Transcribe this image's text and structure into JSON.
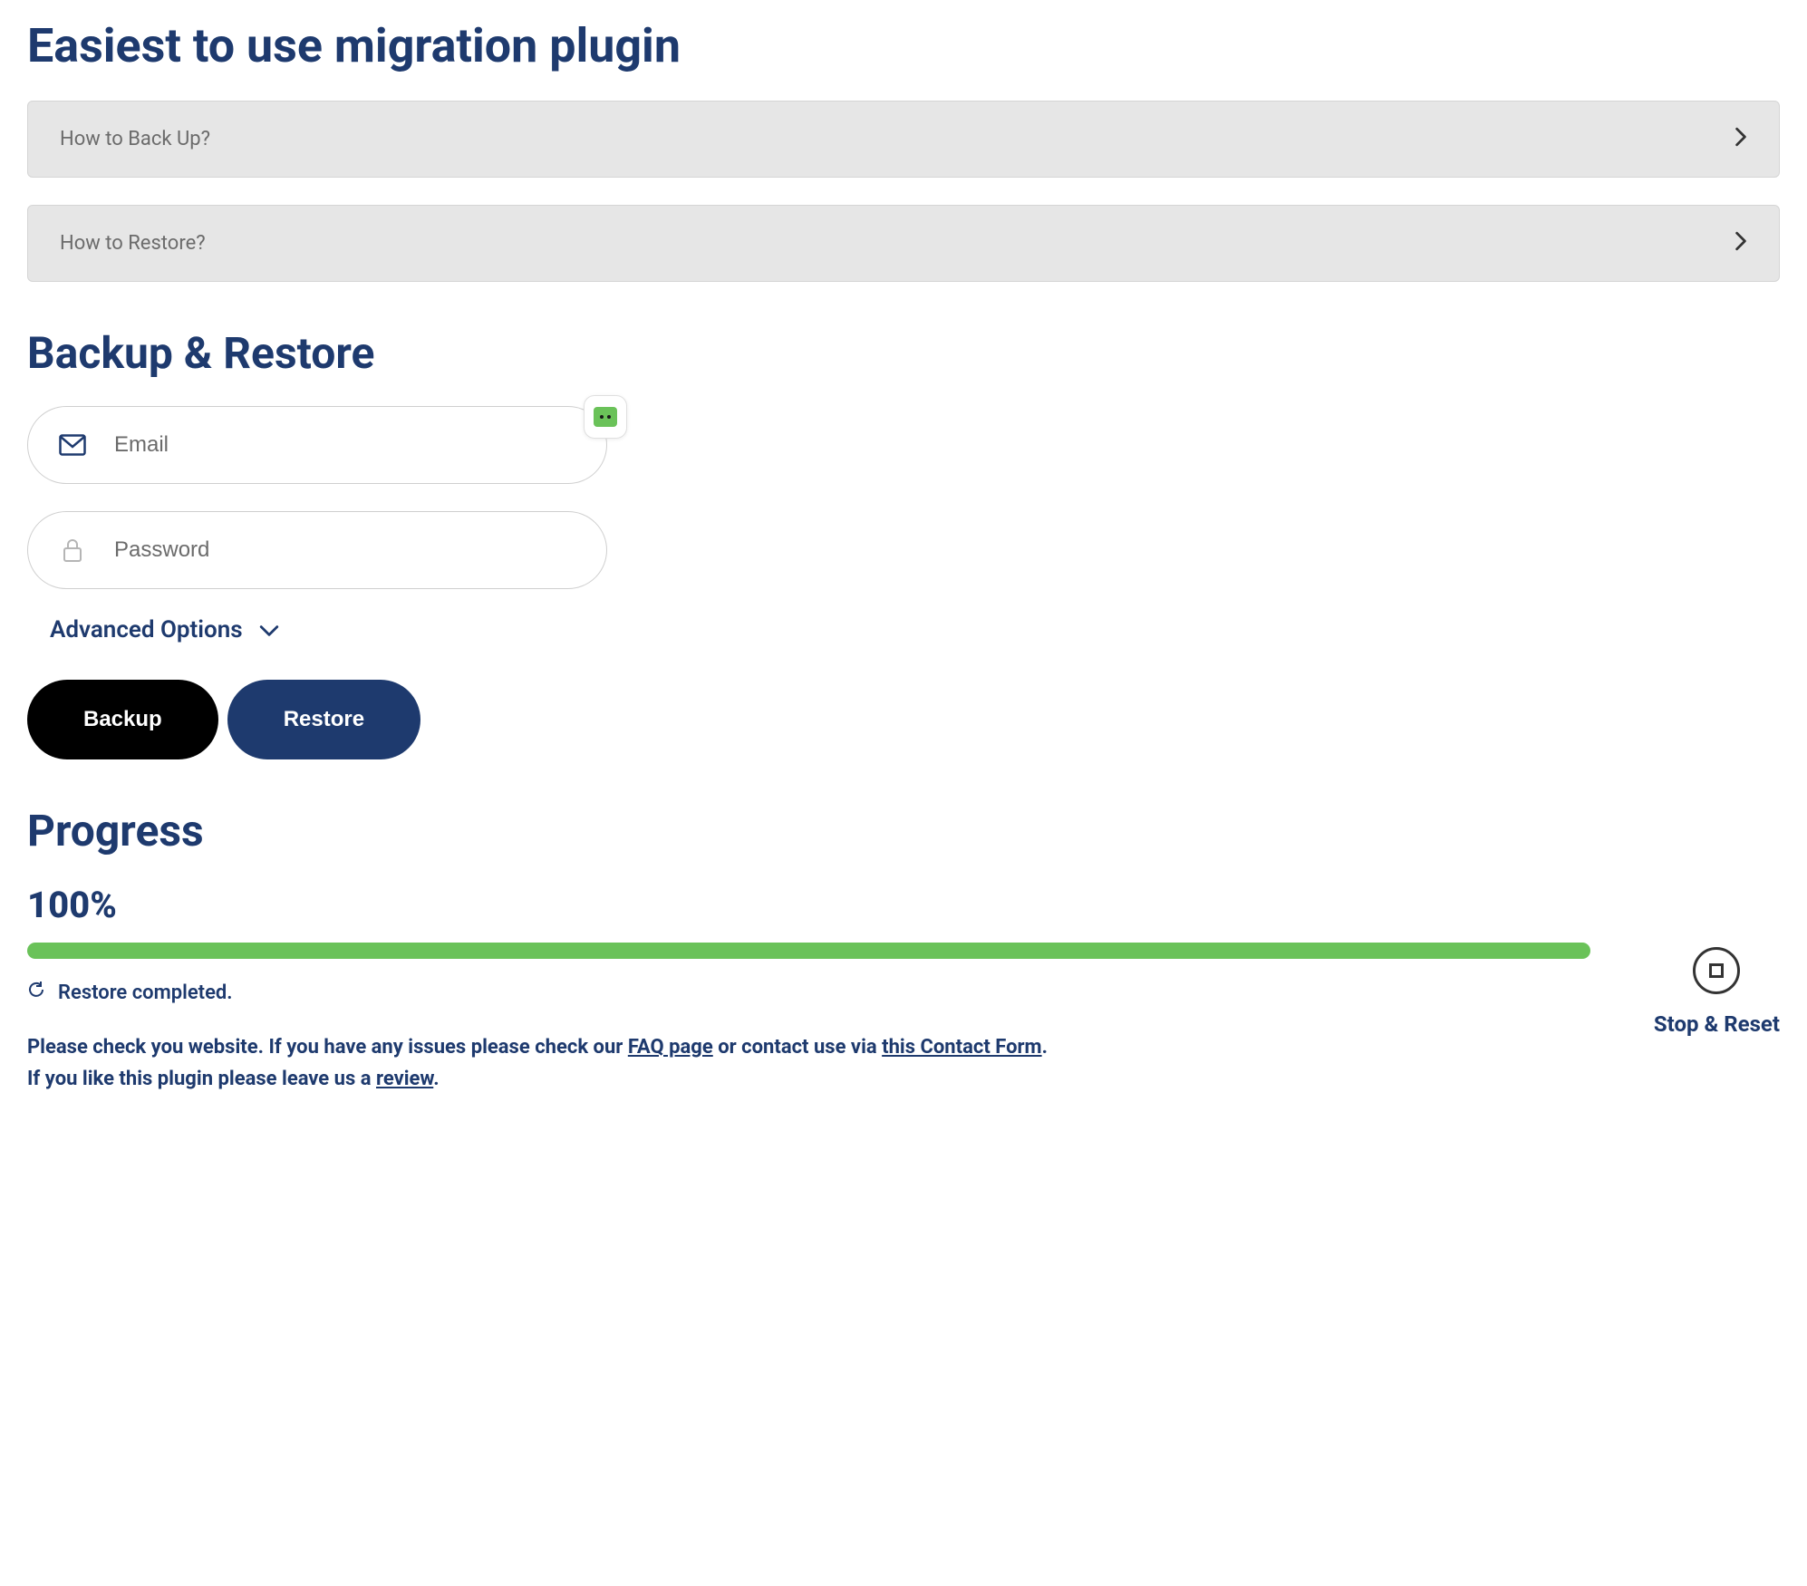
{
  "header": {
    "title": "Easiest to use migration plugin"
  },
  "accordions": {
    "backup": {
      "label": "How to Back Up?"
    },
    "restore": {
      "label": "How to Restore?"
    }
  },
  "backup_restore": {
    "title": "Backup & Restore",
    "email_placeholder": "Email",
    "password_placeholder": "Password",
    "advanced_label": "Advanced Options",
    "backup_button": "Backup",
    "restore_button": "Restore"
  },
  "progress": {
    "title": "Progress",
    "percent": "100%",
    "value": 100,
    "status": "Restore completed.",
    "info_prefix": "Please check you website. If you have any issues please check our ",
    "faq_link": "FAQ page",
    "info_mid": " or contact use via ",
    "contact_link": "this Contact Form",
    "info_period": ".",
    "info_line2_prefix": "If you like this plugin please leave us a ",
    "review_link": "review",
    "info_line2_suffix": ".",
    "stop_reset": "Stop & Reset"
  },
  "colors": {
    "primary": "#1e3a6e",
    "success": "#6ac259",
    "black": "#000000"
  }
}
